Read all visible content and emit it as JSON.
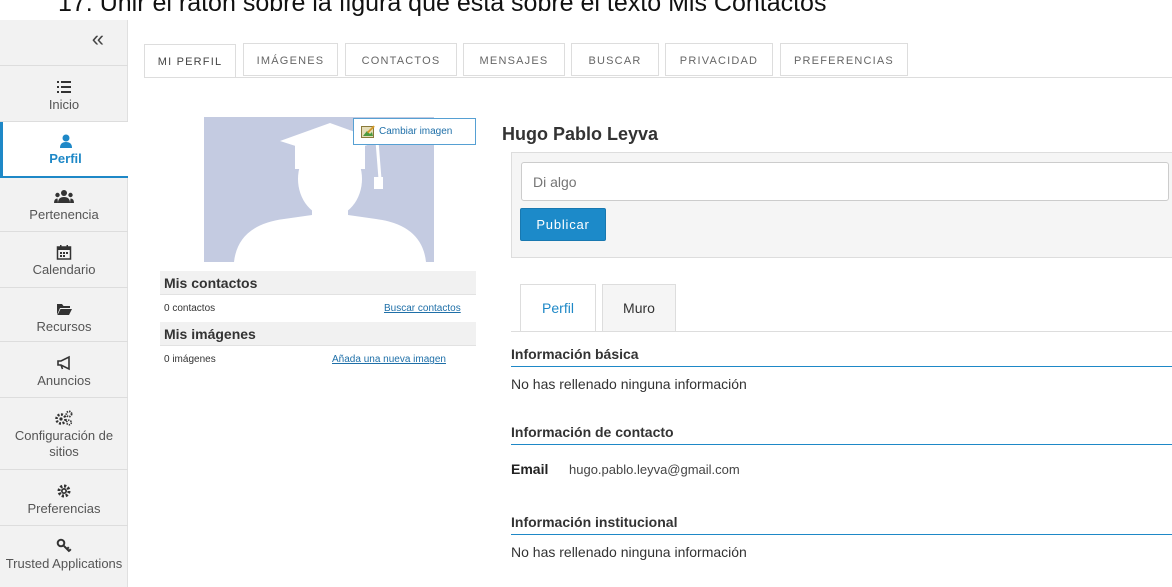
{
  "caption": "17. Unir el ratón sobre la figura que está sobre el texto Mis Contactos",
  "sidebar": {
    "collapse_icon": "double-chevron-left-icon",
    "items": [
      {
        "label": "Inicio",
        "icon": "list-icon"
      },
      {
        "label": "Perfil",
        "icon": "user-icon",
        "active": true
      },
      {
        "label": "Pertenencia",
        "icon": "users-icon"
      },
      {
        "label": "Calendario",
        "icon": "calendar-icon"
      },
      {
        "label": "Recursos",
        "icon": "folder-icon"
      },
      {
        "label": "Anuncios",
        "icon": "megaphone-icon"
      },
      {
        "label": "Configuración de sitios",
        "icon": "gears-icon"
      },
      {
        "label": "Preferencias",
        "icon": "gear-icon"
      },
      {
        "label": "Trusted Applications",
        "icon": "key-icon"
      }
    ]
  },
  "tabs": [
    "MI PERFIL",
    "IMÁGENES",
    "CONTACTOS",
    "MENSAJES",
    "BUSCAR",
    "PRIVACIDAD",
    "PREFERENCIAS"
  ],
  "profile": {
    "change_image": "Cambiar imagen",
    "contacts_title": "Mis contactos",
    "contacts_count": "0 contactos",
    "search_contacts": "Buscar contactos",
    "images_title": "Mis imágenes",
    "images_count": "0 imágenes",
    "add_image": "Añada una nueva imagen"
  },
  "main": {
    "name": "Hugo Pablo Leyva",
    "post_placeholder": "Di algo",
    "publish": "Publicar",
    "subtabs": [
      "Perfil",
      "Muro"
    ],
    "basic_title": "Información básica",
    "basic_text": "No has rellenado ninguna información",
    "contact_title": "Información de contacto",
    "email_label": "Email",
    "email_value": "hugo.pablo.leyva@gmail.com",
    "inst_title": "Información institucional",
    "inst_text": "No has rellenado ninguna información"
  },
  "colors": {
    "accent": "#1e88c7",
    "button": "#1c8ac9",
    "avatar_bg": "#c4cbe1",
    "avatar_fg": "#ffffff"
  }
}
